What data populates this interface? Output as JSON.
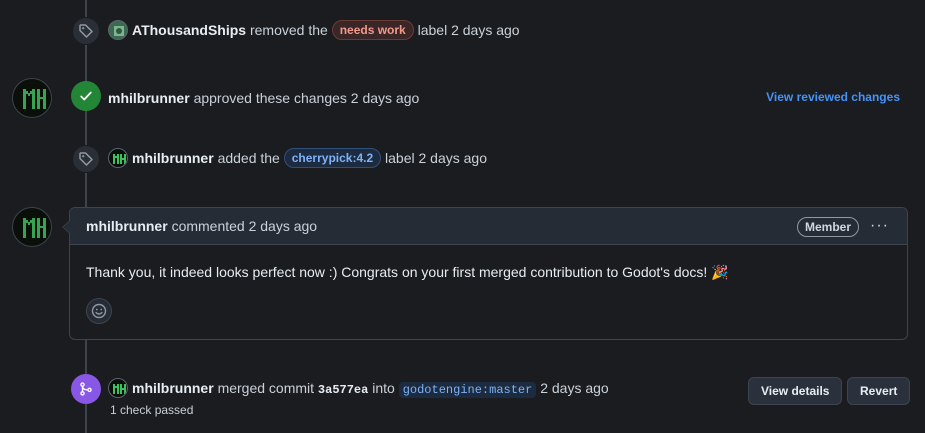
{
  "events": {
    "label_removed": {
      "author": "AThousandShips",
      "action": "removed the",
      "label": "needs work",
      "suffix": "label 2 days ago"
    },
    "approved": {
      "author": "mhilbrunner",
      "action": "approved these changes 2 days ago",
      "link": "View reviewed changes"
    },
    "label_added": {
      "author": "mhilbrunner",
      "action": "added the",
      "label": "cherrypick:4.2",
      "suffix": "label 2 days ago"
    },
    "comment": {
      "author": "mhilbrunner",
      "meta": "commented 2 days ago",
      "badge": "Member",
      "menu": "···",
      "body": "Thank you, it indeed looks perfect now :) Congrats on your first merged contribution to Godot's docs! 🎉"
    },
    "merge": {
      "author": "mhilbrunner",
      "action": "merged commit",
      "commit": "3a577ea",
      "into": "into",
      "branch": "godotengine:master",
      "time": "2 days ago",
      "checks": "1 check passed",
      "view_details": "View details",
      "revert": "Revert"
    }
  },
  "colors": {
    "background": "#1b1c20",
    "link": "#4493f8",
    "approved_green": "#238636",
    "merged_purple": "#8957e5"
  },
  "icons": {
    "label_event": "tag-icon",
    "approve_event": "check-icon",
    "merge_event": "git-merge-icon",
    "reaction": "smiley-icon"
  }
}
